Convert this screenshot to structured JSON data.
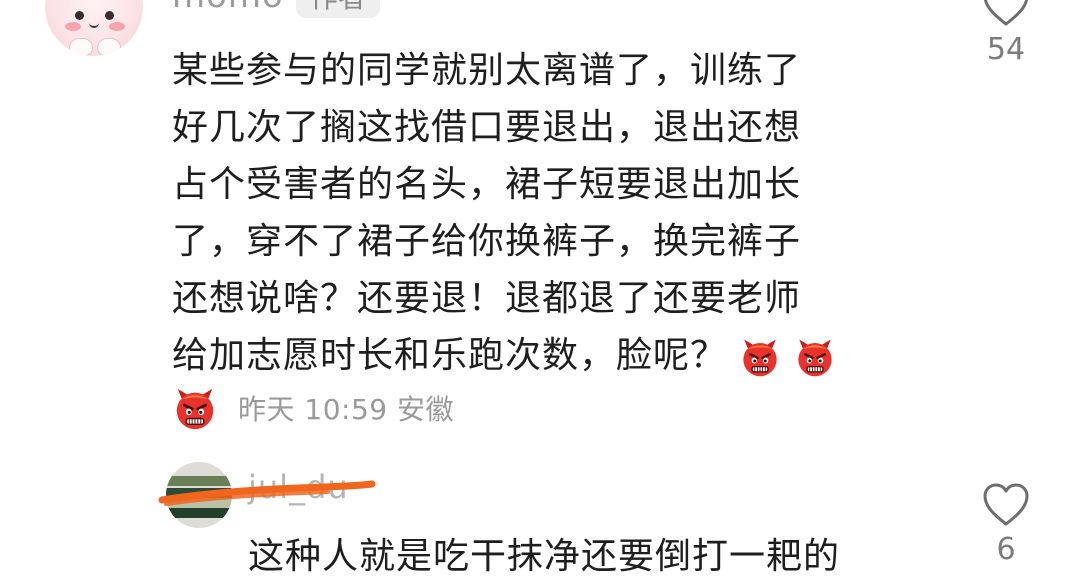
{
  "comments": [
    {
      "username": "momo",
      "badge": "作者",
      "lines": [
        "某些参与的同学就别太离谱了，训练了",
        "好几次了搁这找借口要退出，退出还想",
        "占个受害者的名头，裙子短要退出加长",
        "了，穿不了裙子给你换裤子，换完裤子",
        "还想说啥？还要退！退都退了还要老师",
        "给加志愿时长和乐跑次数，脸呢？"
      ],
      "trailing_emojis": [
        "angry-face-emoji",
        "angry-face-emoji"
      ],
      "reply_emoji": "angry-face-emoji",
      "meta": "昨天 10:59 安徽",
      "like_count": "54",
      "like_icon": "heart-outline-icon"
    },
    {
      "username": "jul_du",
      "username_obscured": true,
      "text": "这种人就是吃干抹净还要倒打一耙的",
      "like_count": "6",
      "like_icon": "heart-outline-icon"
    }
  ],
  "colors": {
    "text_primary": "#1e1e1e",
    "text_secondary": "#9a9a9a",
    "badge_bg": "#efefef",
    "scribble": "#f0661e",
    "emoji_red": "#e8322b"
  }
}
